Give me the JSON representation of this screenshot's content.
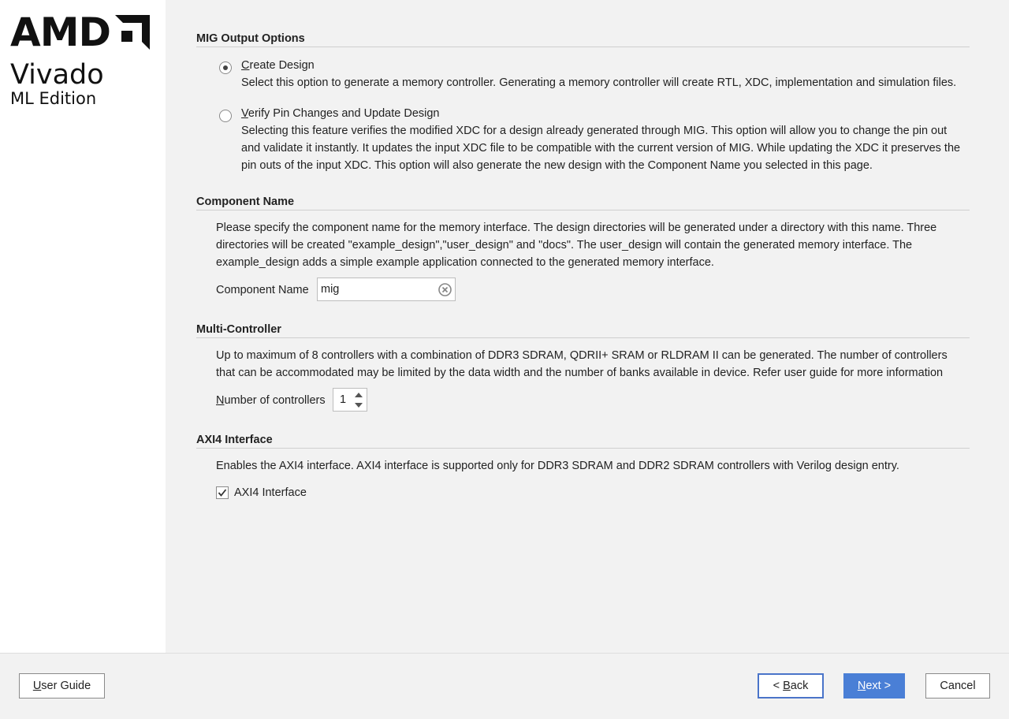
{
  "brand": {
    "company": "AMD",
    "product": "Vivado",
    "edition": "ML Edition"
  },
  "sections": {
    "mig_output": {
      "title": "MIG Output Options",
      "create_design": {
        "label_first": "C",
        "label_rest": "reate Design",
        "description": "Select this option to generate a memory controller. Generating a memory controller will create RTL, XDC, implementation and simulation files.",
        "selected": true
      },
      "verify_pin": {
        "label_first": "V",
        "label_rest": "erify Pin Changes and Update Design",
        "description_lines": [
          "Selecting this feature verifies the modified XDC for a design already generated through MIG. This option will allow you to change the pin out",
          "and validate it instantly. It updates the input XDC file to be compatible with the current version of MIG. While updating the XDC it preserves the",
          "pin outs of the input XDC. This option will also generate the new design with the Component Name you selected in this page."
        ],
        "selected": false
      }
    },
    "component_name": {
      "title": "Component Name",
      "description_lines": [
        "Please specify the component name for the memory interface. The design directories will be generated under a directory with this name. Three",
        "directories will be created \"example_design\",\"user_design\" and \"docs\". The user_design will contain the generated memory interface. The",
        "example_design adds a simple example application connected to the generated memory interface."
      ],
      "field_label": "Component Name",
      "field_value": "mig"
    },
    "multi_controller": {
      "title": "Multi-Controller",
      "description_lines": [
        "Up to maximum of 8 controllers with a combination of DDR3 SDRAM, QDRII+ SRAM or RLDRAM II can be generated. The number of controllers",
        "that can be accommodated may be limited by the data width and the number of banks available in device. Refer user guide for more information"
      ],
      "field_label_first": "N",
      "field_label_rest": "umber of controllers",
      "value": "1"
    },
    "axi4": {
      "title": "AXI4 Interface",
      "description": "Enables the AXI4 interface. AXI4 interface is supported only for DDR3 SDRAM and DDR2 SDRAM controllers with Verilog design entry.",
      "checkbox_label": "AXI4 Interface",
      "checked": true
    }
  },
  "footer": {
    "user_guide_first": "U",
    "user_guide_rest": "ser Guide",
    "back_prefix": "< ",
    "back_first": "B",
    "back_rest": "ack",
    "next_first": "N",
    "next_rest": "ext >",
    "cancel": "Cancel"
  },
  "colors": {
    "next_button": "#4a7fd6",
    "back_focus_border": "#4a74c9",
    "sidebar_bg": "#ffffff",
    "content_bg": "#f2f2f2"
  }
}
